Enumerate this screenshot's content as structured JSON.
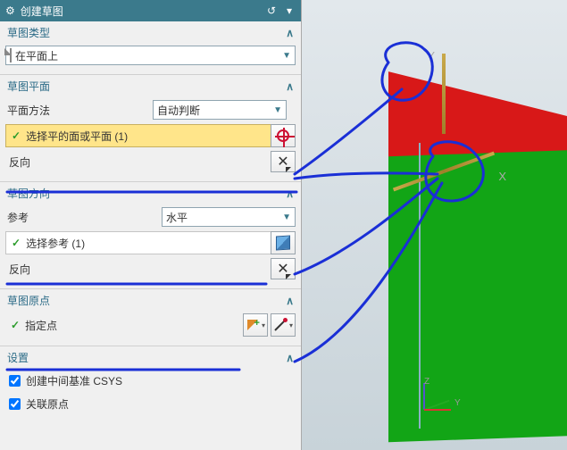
{
  "header": {
    "title": "创建草图"
  },
  "groups": {
    "type": {
      "title": "草图类型",
      "dropdown": "在平面上"
    },
    "plane": {
      "title": "草图平面",
      "method_label": "平面方法",
      "method_value": "自动判断",
      "select_label": "选择平的面或平面 (1)",
      "reverse_label": "反向"
    },
    "orient": {
      "title": "草图方向",
      "ref_label": "参考",
      "ref_value": "水平",
      "select_label": "选择参考 (1)",
      "reverse_label": "反向"
    },
    "origin": {
      "title": "草图原点",
      "point_label": "指定点"
    },
    "settings": {
      "title": "设置",
      "chk1": "创建中间基准 CSYS",
      "chk2": "关联原点"
    }
  },
  "axes": {
    "x": "X",
    "y": "Y",
    "z": "Z"
  }
}
